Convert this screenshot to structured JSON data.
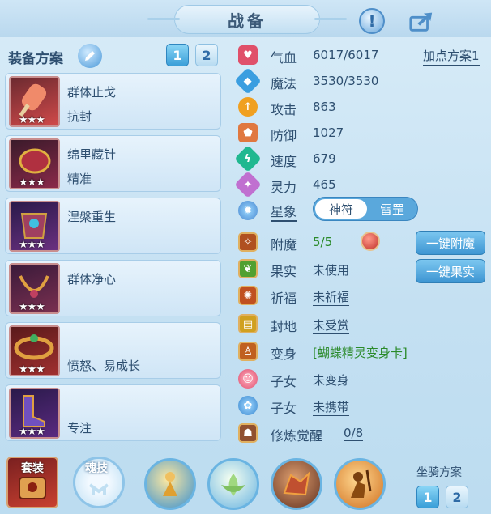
{
  "header": {
    "title": "战备",
    "hint_icon": "exclamation-icon",
    "share_icon": "share-icon"
  },
  "scheme": {
    "label": "装备方案",
    "buttons": [
      "1",
      "2"
    ],
    "active": 0
  },
  "equipment": [
    {
      "name": "群体止戈",
      "sub": "抗封",
      "stars": "★★★",
      "icon": "popsicle-icon",
      "color": "#d04a4a"
    },
    {
      "name": "绵里藏针",
      "sub": "精准",
      "stars": "★★★",
      "icon": "vambrace-icon",
      "color": "#8a2a4a"
    },
    {
      "name": "涅槃重生",
      "sub": "",
      "stars": "★★★",
      "icon": "armor-icon",
      "color": "#6a3080"
    },
    {
      "name": "群体净心",
      "sub": "",
      "stars": "★★★",
      "icon": "necklace-icon",
      "color": "#7a3050"
    },
    {
      "name": "",
      "sub": "愤怒、易成长",
      "stars": "★★★",
      "icon": "belt-icon",
      "color": "#a03030"
    },
    {
      "name": "",
      "sub": "专注",
      "stars": "★★★",
      "icon": "boots-icon",
      "color": "#5a2a80"
    }
  ],
  "attributes": [
    {
      "label": "气血",
      "value": "6017/6017",
      "icon": "heart-icon",
      "color": "#e0506a"
    },
    {
      "label": "魔法",
      "value": "3530/3530",
      "icon": "mana-icon",
      "color": "#3a9ee0"
    },
    {
      "label": "攻击",
      "value": "863",
      "icon": "attack-icon",
      "color": "#f0a020"
    },
    {
      "label": "防御",
      "value": "1027",
      "icon": "defense-icon",
      "color": "#e07840"
    },
    {
      "label": "速度",
      "value": "679",
      "icon": "speed-icon",
      "color": "#20b890"
    },
    {
      "label": "灵力",
      "value": "465",
      "icon": "spirit-icon",
      "color": "#c070d0"
    }
  ],
  "plan_link": "加点方案1",
  "star_sign": {
    "label": "星象",
    "options": [
      "神符",
      "雷罡"
    ],
    "selected": 0
  },
  "status": [
    {
      "label": "附魔",
      "value": "5/5",
      "style": "green",
      "icon": "enchant-icon"
    },
    {
      "label": "果实",
      "value": "未使用",
      "style": "plain",
      "icon": "fruit-icon"
    },
    {
      "label": "祈福",
      "value": "未祈福",
      "style": "underline",
      "icon": "bless-icon"
    },
    {
      "label": "封地",
      "value": "未受赏",
      "style": "underline",
      "icon": "fief-icon"
    },
    {
      "label": "变身",
      "value": "[蝴蝶精灵变身卡]",
      "style": "green",
      "icon": "transform-icon"
    },
    {
      "label": "子女",
      "value": "未变身",
      "style": "underline",
      "icon": "child-icon"
    },
    {
      "label": "子女",
      "value": "未携带",
      "style": "underline",
      "icon": "paw-icon"
    },
    {
      "label": "修炼觉醒",
      "value": "0/8",
      "style": "underline",
      "icon": "cultivate-icon"
    }
  ],
  "actions": {
    "enchant": "一键附魔",
    "fruit": "一键果实"
  },
  "bottom": {
    "suit": "套装",
    "soul": "魂技",
    "mount_label": "坐骑方案",
    "mount_buttons": [
      "1",
      "2"
    ],
    "mount_active": 0
  }
}
